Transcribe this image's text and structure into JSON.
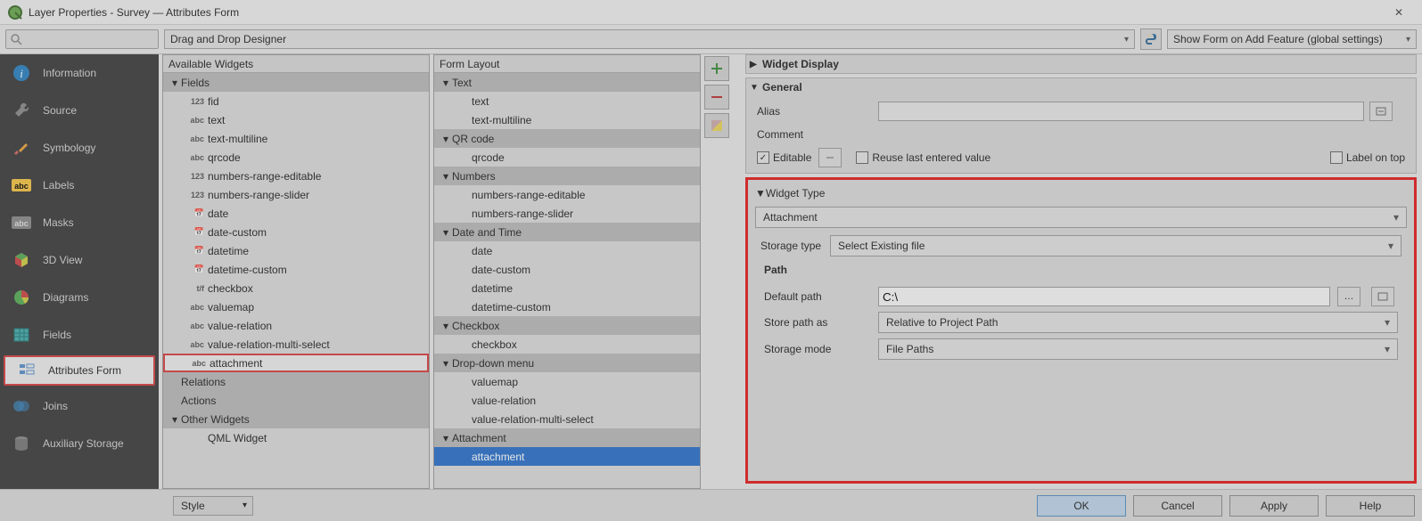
{
  "window_title": "Layer Properties - Survey — Attributes Form",
  "toprow": {
    "designer_label": "Drag and Drop Designer",
    "show_form_label": "Show Form on Add Feature (global settings)"
  },
  "sidebar": {
    "items": [
      {
        "label": "Information"
      },
      {
        "label": "Source"
      },
      {
        "label": "Symbology"
      },
      {
        "label": "Labels"
      },
      {
        "label": "Masks"
      },
      {
        "label": "3D View"
      },
      {
        "label": "Diagrams"
      },
      {
        "label": "Fields"
      },
      {
        "label": "Attributes Form"
      },
      {
        "label": "Joins"
      },
      {
        "label": "Auxiliary Storage"
      }
    ]
  },
  "available": {
    "header": "Available Widgets",
    "groups": [
      {
        "label": "Fields",
        "items": [
          {
            "type": "123",
            "label": "fid"
          },
          {
            "type": "abc",
            "label": "text"
          },
          {
            "type": "abc",
            "label": "text-multiline"
          },
          {
            "type": "abc",
            "label": "qrcode"
          },
          {
            "type": "123",
            "label": "numbers-range-editable"
          },
          {
            "type": "123",
            "label": "numbers-range-slider"
          },
          {
            "type": "📅",
            "label": "date"
          },
          {
            "type": "📅",
            "label": "date-custom"
          },
          {
            "type": "📅",
            "label": "datetime"
          },
          {
            "type": "📅",
            "label": "datetime-custom"
          },
          {
            "type": "t/f",
            "label": "checkbox"
          },
          {
            "type": "abc",
            "label": "valuemap"
          },
          {
            "type": "abc",
            "label": "value-relation"
          },
          {
            "type": "abc",
            "label": "value-relation-multi-select"
          },
          {
            "type": "abc",
            "label": "attachment"
          }
        ]
      },
      {
        "label": "Relations",
        "items": []
      },
      {
        "label": "Actions",
        "items": []
      },
      {
        "label": "Other Widgets",
        "items": [
          {
            "type": "",
            "label": "QML Widget"
          }
        ]
      }
    ]
  },
  "formlayout": {
    "header": "Form Layout",
    "groups": [
      {
        "label": "Text",
        "items": [
          "text",
          "text-multiline"
        ]
      },
      {
        "label": "QR code",
        "items": [
          "qrcode"
        ]
      },
      {
        "label": "Numbers",
        "items": [
          "numbers-range-editable",
          "numbers-range-slider"
        ]
      },
      {
        "label": "Date and Time",
        "items": [
          "date",
          "date-custom",
          "datetime",
          "datetime-custom"
        ]
      },
      {
        "label": "Checkbox",
        "items": [
          "checkbox"
        ]
      },
      {
        "label": "Drop-down menu",
        "items": [
          "valuemap",
          "value-relation",
          "value-relation-multi-select"
        ]
      },
      {
        "label": "Attachment",
        "items": [
          "attachment"
        ]
      }
    ]
  },
  "widget_display": {
    "title": "Widget Display"
  },
  "general": {
    "title": "General",
    "alias_label": "Alias",
    "alias_value": "",
    "comment_label": "Comment",
    "editable_label": "Editable",
    "reuse_label": "Reuse last entered value",
    "labelontop_label": "Label on top"
  },
  "widget_type": {
    "title": "Widget Type",
    "type_value": "Attachment",
    "storage_type_label": "Storage type",
    "storage_type_value": "Select Existing file",
    "path_title": "Path",
    "default_path_label": "Default path",
    "default_path_value": "C:\\",
    "store_path_as_label": "Store path as",
    "store_path_as_value": "Relative to Project Path",
    "storage_mode_label": "Storage mode",
    "storage_mode_value": "File Paths"
  },
  "buttons": {
    "style": "Style",
    "ok": "OK",
    "cancel": "Cancel",
    "apply": "Apply",
    "help": "Help"
  }
}
